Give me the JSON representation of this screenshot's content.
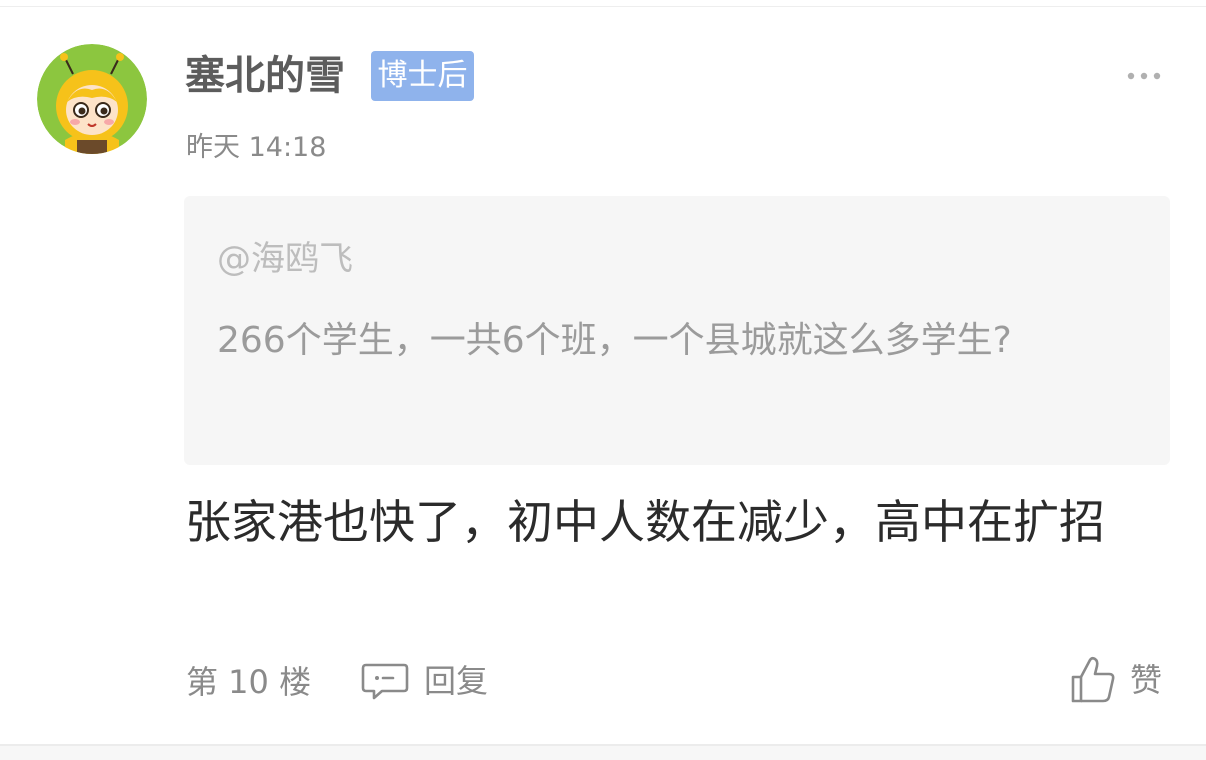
{
  "post": {
    "username": "塞北的雪",
    "badge": "博士后",
    "timestamp": "昨天 14:18",
    "avatar_icon": "cartoon-bee-avatar",
    "more_icon": "more-dots-icon",
    "quote": {
      "author": "@海鸥飞",
      "text": "266个学生，一共6个班，一个县城就这么多学生?"
    },
    "content": "张家港也快了，初中人数在减少，高中在扩招",
    "footer": {
      "floor": "第 10 楼",
      "reply_label": "回复",
      "like_label": "赞"
    }
  },
  "colors": {
    "badge_bg": "#8fb3ec",
    "avatar_bg": "#8cc63f",
    "quote_bg": "#f6f6f6"
  }
}
